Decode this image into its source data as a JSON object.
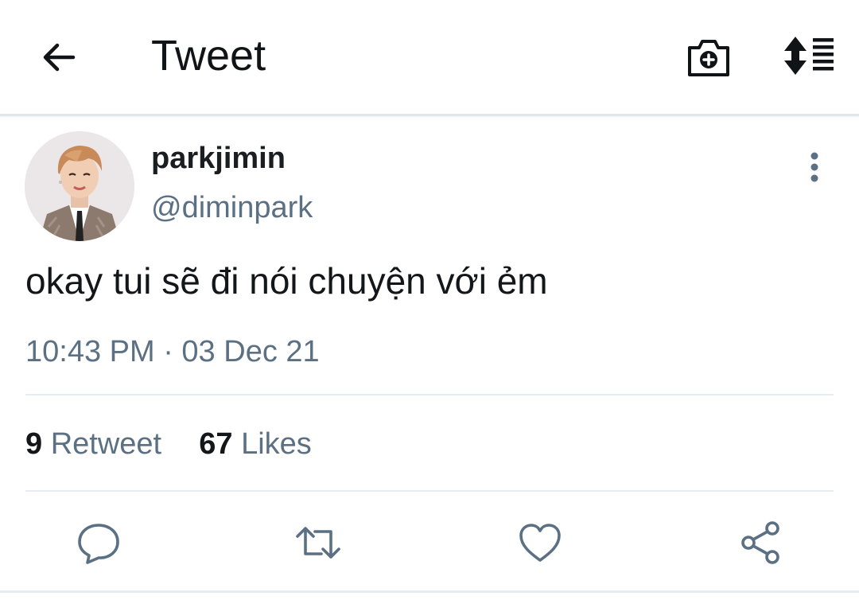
{
  "header": {
    "back_icon": "arrow-left-icon",
    "title": "Tweet",
    "camera_icon": "camera-plus-icon",
    "sort_icon": "sort-list-icon"
  },
  "tweet": {
    "display_name": "parkjimin",
    "handle": "@diminpark",
    "text": "okay tui sẽ đi nói chuyện với ẻm",
    "timestamp": "10:43 PM · 03 Dec 21",
    "more_icon": "more-vertical-icon"
  },
  "stats": {
    "retweet_count": "9",
    "retweet_label": "Retweet",
    "likes_count": "67",
    "likes_label": "Likes"
  },
  "actions": [
    {
      "icon": "reply-icon"
    },
    {
      "icon": "retweet-icon"
    },
    {
      "icon": "like-icon"
    },
    {
      "icon": "share-icon"
    }
  ],
  "colors": {
    "primary_text": "#14171a",
    "secondary_text": "#5b7083",
    "divider": "#e6ecf0",
    "icon": "#5b7083"
  }
}
